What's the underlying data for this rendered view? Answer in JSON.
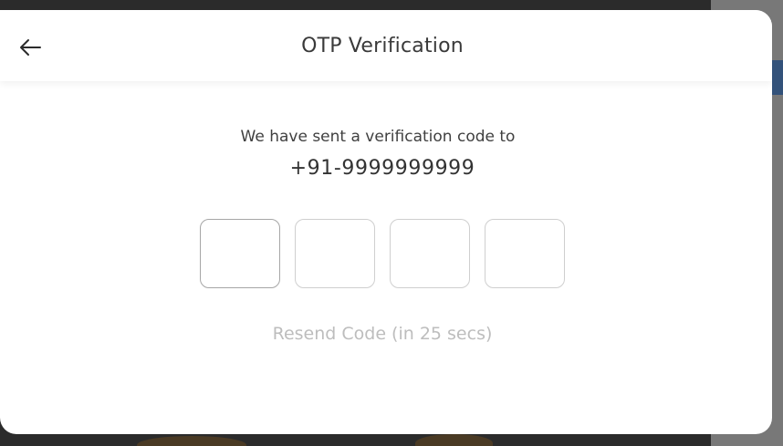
{
  "modal": {
    "title": "OTP Verification",
    "back_icon": "arrow-left-icon"
  },
  "message": {
    "sent_text": "We have sent a verification code to",
    "phone": "+91-9999999999"
  },
  "otp": {
    "digit_count": 4,
    "values": [
      "",
      "",
      "",
      ""
    ]
  },
  "resend": {
    "label": "Resend Code (in 25 secs)",
    "color": "#bdbdbd"
  }
}
